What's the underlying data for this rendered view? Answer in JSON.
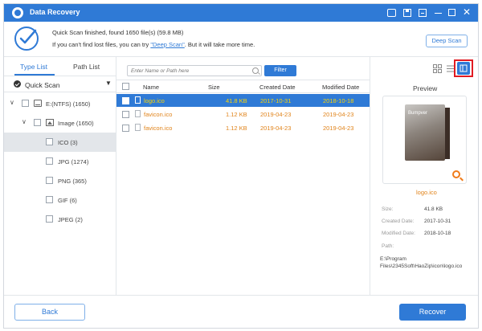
{
  "window": {
    "title": "Data Recovery"
  },
  "info": {
    "line1": "Quick Scan finished, found 1650 file(s) (59.8 MB)",
    "line2_prefix": "If you can't find lost files, you can try ",
    "line2_link": "\"Deep Scan\"",
    "line2_suffix": ". But it will take more time.",
    "deep_scan_label": "Deep Scan"
  },
  "sidebar": {
    "tabs": [
      "Type List",
      "Path List"
    ],
    "active_tab": "Type List",
    "scan_mode": "Quick Scan",
    "tree": [
      {
        "label": "E:(NTFS) (1650)",
        "level": 0,
        "expanded": true,
        "icon": "drive-icon"
      },
      {
        "label": "Image (1650)",
        "level": 1,
        "expanded": true,
        "icon": "image-icon"
      },
      {
        "label": "ICO (3)",
        "level": 2,
        "selected": true
      },
      {
        "label": "JPG (1274)",
        "level": 2
      },
      {
        "label": "PNG (365)",
        "level": 2
      },
      {
        "label": "GIF (6)",
        "level": 2
      },
      {
        "label": "JPEG (2)",
        "level": 2
      }
    ]
  },
  "search": {
    "placeholder": "Enter Name or Path here",
    "filter_label": "Filter"
  },
  "table": {
    "columns": [
      "Name",
      "Size",
      "Created Date",
      "Modified Date"
    ],
    "rows": [
      {
        "name": "logo.ico",
        "size": "41.8 KB",
        "created": "2017-10-31",
        "modified": "2018-10-18",
        "selected": true
      },
      {
        "name": "favicon.ico",
        "size": "1.12 KB",
        "created": "2019-04-23",
        "modified": "2019-04-23"
      },
      {
        "name": "favicon.ico",
        "size": "1.12 KB",
        "created": "2019-04-23",
        "modified": "2019-04-23"
      }
    ]
  },
  "preview": {
    "title": "Preview",
    "brand": "Bumpver",
    "file_name": "logo.ico",
    "size_label": "Size:",
    "size": "41.8 KB",
    "created_label": "Created Date:",
    "created": "2017-10-31",
    "modified_label": "Modified Date:",
    "modified": "2018-10-18",
    "path_label": "Path:",
    "path": "E:\\Program Files\\2345Soft\\HaoZip\\icon\\logo.ico"
  },
  "footer": {
    "back_label": "Back",
    "recover_label": "Recover"
  },
  "colors": {
    "accent": "#2f7ad6",
    "file_text": "#e0831a",
    "selected_text": "#ffd600",
    "highlight": "#e11b22"
  }
}
